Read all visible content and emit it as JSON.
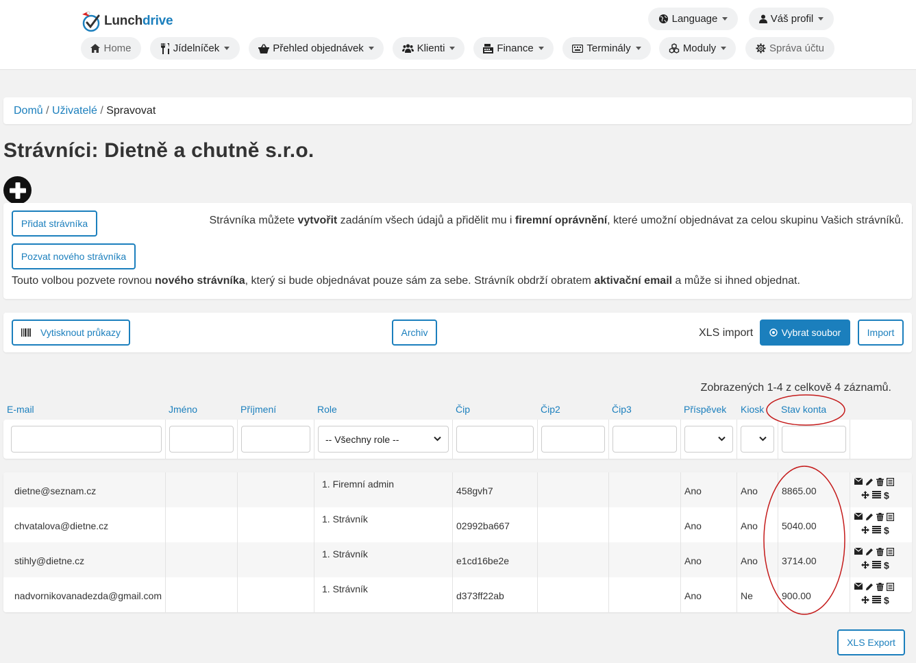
{
  "header": {
    "logo_prefix": "Lunch",
    "logo_suffix": "drive",
    "language_label": "Language",
    "profile_label": "Váš profil",
    "nav": {
      "home": "Home",
      "menu": "Jídelníček",
      "orders": "Přehled objednávek",
      "clients": "Klienti",
      "finance": "Finance",
      "terminals": "Terminály",
      "modules": "Moduly",
      "account": "Správa účtu"
    }
  },
  "breadcrumb": {
    "home": "Domů",
    "sep1": "/",
    "users": "Uživatelé",
    "sep2": "/",
    "current": "Spravovat"
  },
  "page_title": "Strávníci: Dietně a chutně s.r.o.",
  "add_panel": {
    "add_button": "Přidat strávníka",
    "add_text_1": "Strávníka můžete ",
    "add_text_b1": "vytvořit",
    "add_text_2": " zadáním všech údajů a přidělit mu i ",
    "add_text_b2": "firemní oprávnění",
    "add_text_3": ", které umožní objednávat za celou skupinu Vašich strávníků.",
    "invite_button": "Pozvat nového strávníka",
    "invite_text_1": "Touto volbou pozvete rovnou ",
    "invite_text_b1": "nového strávníka",
    "invite_text_2": ", který si bude objednávat pouze sám za sebe. Strávník obdrží obratem ",
    "invite_text_b2": "aktivační email",
    "invite_text_3": " a může si ihned objednat."
  },
  "toolbar": {
    "print_cards": "Vytisknout průkazy",
    "archive": "Archiv",
    "xls_import_label": "XLS import",
    "choose_file": "Vybrat soubor",
    "import": "Import"
  },
  "summary": "Zobrazených 1-4 z celkově 4 záznamů.",
  "columns": {
    "email": "E-mail",
    "first_name": "Jméno",
    "last_name": "Příjmení",
    "role": "Role",
    "chip": "Čip",
    "chip2": "Čip2",
    "chip3": "Čip3",
    "contribution": "Příspěvek",
    "kiosk": "Kiosk",
    "balance": "Stav konta"
  },
  "filters": {
    "role_selected": "-- Všechny role --"
  },
  "rows": [
    {
      "email": "dietne@seznam.cz",
      "first_name": "",
      "last_name": "",
      "role": "1. Firemní admin",
      "chip": "458gvh7",
      "chip2": "",
      "chip3": "",
      "contribution": "Ano",
      "kiosk": "Ano",
      "balance": "8865.00"
    },
    {
      "email": "chvatalova@dietne.cz",
      "first_name": "",
      "last_name": "",
      "role": "1. Strávník",
      "chip": "02992ba667",
      "chip2": "",
      "chip3": "",
      "contribution": "Ano",
      "kiosk": "Ano",
      "balance": "5040.00"
    },
    {
      "email": "stihly@dietne.cz",
      "first_name": "",
      "last_name": "",
      "role": "1. Strávník",
      "chip": "e1cd16be2e",
      "chip2": "",
      "chip3": "",
      "contribution": "Ano",
      "kiosk": "Ano",
      "balance": "3714.00"
    },
    {
      "email": "nadvornikovanadezda@gmail.com",
      "first_name": "",
      "last_name": "",
      "role": "1. Strávník",
      "chip": "d373ff22ab",
      "chip2": "",
      "chip3": "",
      "contribution": "Ano",
      "kiosk": "Ne",
      "balance": "900.00"
    }
  ],
  "row_actions": [
    "envelope-icon",
    "pencil-icon",
    "trash-icon",
    "list-icon",
    "move-icon",
    "lines-icon",
    "dollar-icon"
  ],
  "xls_export": "XLS Export",
  "colors": {
    "accent": "#1b7fbd",
    "annotation": "#c41a1a"
  }
}
